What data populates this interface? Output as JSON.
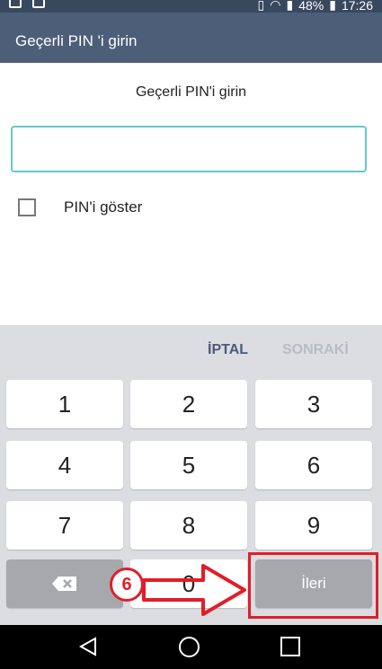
{
  "status": {
    "battery": "48%",
    "time": "17:26"
  },
  "appbar": {
    "title": "Geçerli PIN 'i girin"
  },
  "main": {
    "prompt": "Geçerli PIN'i girin",
    "pin_value": "",
    "show_pin_label": "PIN'i göster"
  },
  "keyboard": {
    "cancel_label": "İPTAL",
    "next_label": "SONRAKİ",
    "keys": [
      "1",
      "2",
      "3",
      "4",
      "5",
      "6",
      "7",
      "8",
      "9",
      "0"
    ],
    "forward_label": "İleri"
  },
  "annotation": {
    "step_number": "6",
    "color": "#e01e2a"
  },
  "icons": {
    "back": "backspace-icon",
    "nav_back": "triangle-back-icon",
    "nav_home": "circle-home-icon",
    "nav_recent": "square-recent-icon"
  }
}
